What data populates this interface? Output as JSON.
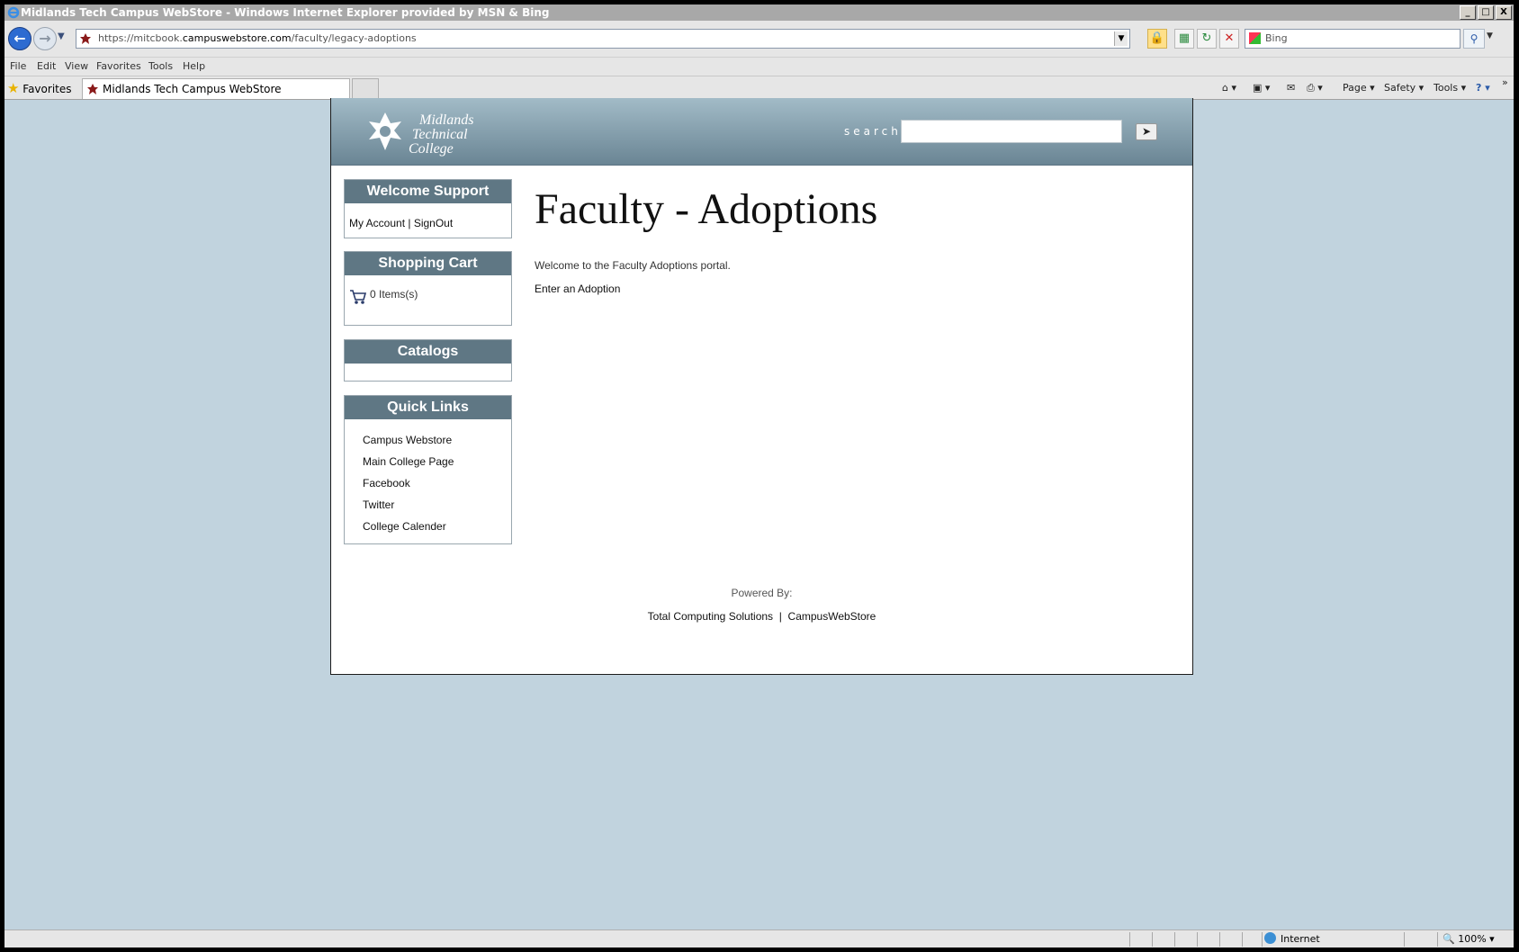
{
  "window": {
    "title": "Midlands Tech Campus WebStore - Windows Internet Explorer provided by MSN & Bing",
    "minimize": "_",
    "maximize": "□",
    "close": "X"
  },
  "addressbar": {
    "url_prefix": "https://mitcbook.",
    "url_domain": "campuswebstore.com",
    "url_path": "/faculty/legacy-adoptions",
    "search_placeholder": "Bing"
  },
  "menu": [
    "File",
    "Edit",
    "View",
    "Favorites",
    "Tools",
    "Help"
  ],
  "favorites_bar": {
    "favorites_label": "Favorites",
    "tab_title": "Midlands Tech Campus WebStore"
  },
  "commandbar": {
    "page": "Page",
    "safety": "Safety",
    "tools": "Tools"
  },
  "site": {
    "logo_text": [
      "Midlands",
      "Technical",
      "College"
    ],
    "search_label": "search",
    "search_go": "➤"
  },
  "sidebar": {
    "welcome": {
      "title": "Welcome Support",
      "my_account": "My Account",
      "separator": " | ",
      "sign_out": "SignOut"
    },
    "cart": {
      "title": "Shopping Cart",
      "items": "0 Items(s)"
    },
    "catalogs": {
      "title": "Catalogs"
    },
    "quick_links": {
      "title": "Quick Links",
      "items": [
        "Campus Webstore",
        "Main College Page",
        "Facebook",
        "Twitter",
        "College Calender"
      ]
    }
  },
  "main": {
    "title": "Faculty - Adoptions",
    "welcome": "Welcome to the Faculty Adoptions portal.",
    "enter_adoption": "Enter an Adoption"
  },
  "footer": {
    "powered_by": "Powered By:",
    "tcs": "Total Computing Solutions",
    "separator": "|",
    "cws": "CampusWebStore"
  },
  "statusbar": {
    "zone": "Internet",
    "zoom": "100%"
  }
}
